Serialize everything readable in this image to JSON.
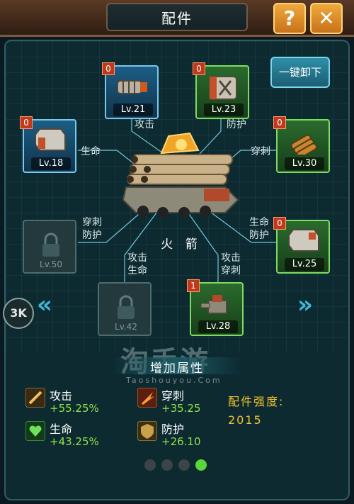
{
  "header": {
    "title": "配件",
    "help_label": "?",
    "close_label": "✕"
  },
  "unload_all_label": "一键卸下",
  "center": {
    "name": "火 箭",
    "icon": "rocket-launcher-vehicle"
  },
  "slots": [
    {
      "id": "attack",
      "level": "Lv.21",
      "badge": "0",
      "tier": "blue",
      "icon": "cylinder-part-icon"
    },
    {
      "id": "defense",
      "level": "Lv.23",
      "badge": "0",
      "tier": "green",
      "icon": "armor-crate-icon"
    },
    {
      "id": "health",
      "level": "Lv.18",
      "badge": "0",
      "tier": "blue",
      "icon": "metal-plate-icon"
    },
    {
      "id": "pierce",
      "level": "Lv.30",
      "badge": "0",
      "tier": "green",
      "icon": "shells-icon"
    },
    {
      "id": "pierce-defense",
      "level": "Lv.50",
      "badge": "",
      "tier": "locked",
      "icon": "lock-icon"
    },
    {
      "id": "health-defense",
      "level": "Lv.25",
      "badge": "0",
      "tier": "green",
      "icon": "metal-plate-icon"
    },
    {
      "id": "attack-health",
      "level": "Lv.42",
      "badge": "",
      "tier": "locked",
      "icon": "lock-icon"
    },
    {
      "id": "attack-pierce",
      "level": "Lv.28",
      "badge": "1",
      "tier": "green",
      "icon": "turret-icon"
    }
  ],
  "connector_labels": {
    "attack": "攻击",
    "defense": "防护",
    "health": "生命",
    "pierce": "穿刺",
    "pierce_defense_1": "穿刺",
    "pierce_defense_2": "防护",
    "health_defense_1": "生命",
    "health_defense_2": "防护",
    "attack_health_1": "攻击",
    "attack_health_2": "生命",
    "attack_pierce_1": "攻击",
    "attack_pierce_2": "穿刺"
  },
  "nav": {
    "prev": "«",
    "next": "»",
    "side_logo": "3K"
  },
  "watermark": {
    "main": "淘手游",
    "sub": "Taoshouyou.Com"
  },
  "attributes_title": "增加属性",
  "attributes": [
    {
      "name": "攻击",
      "value": "+55.25%",
      "icon": "attack-icon"
    },
    {
      "name": "穿刺",
      "value": "+35.25",
      "icon": "pierce-icon"
    },
    {
      "name": "生命",
      "value": "+43.25%",
      "icon": "health-icon"
    },
    {
      "name": "防护",
      "value": "+26.10",
      "icon": "defense-icon"
    }
  ],
  "strength": {
    "label": "配件强度:",
    "value": "2015"
  },
  "pagination": {
    "count": 4,
    "active_index": 3
  },
  "colors": {
    "positive_value": "#8fe24a",
    "strength_text": "#f2c12e",
    "rare_slot_border": "#79c8ef",
    "epic_slot_border": "#7fdc63",
    "badge": "#c0391c"
  }
}
